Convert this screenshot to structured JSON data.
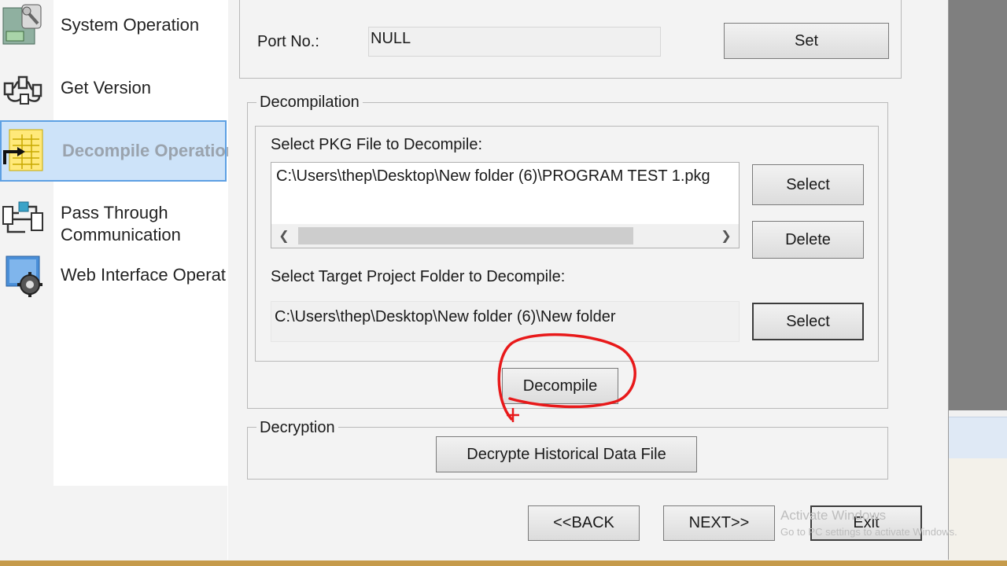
{
  "sidebar": {
    "items": [
      {
        "label": "System Operation",
        "icon": "system-operation-icon"
      },
      {
        "label": "Get Version",
        "icon": "get-version-icon"
      },
      {
        "label": "Decompile Operation",
        "icon": "decompile-operation-icon",
        "active": true
      },
      {
        "label": "Pass Through Communication",
        "line1": "Pass Through",
        "line2": "Communication",
        "icon": "pass-through-icon"
      },
      {
        "label": "Web Interface Operation",
        "icon": "web-interface-icon"
      }
    ]
  },
  "port": {
    "label": "Port No.:",
    "value": "NULL",
    "set_button": "Set"
  },
  "decompilation": {
    "title": "Decompilation",
    "pkg_label": "Select PKG File to Decompile:",
    "pkg_path": "C:\\Users\\thep\\Desktop\\New folder (6)\\PROGRAM TEST 1.pkg",
    "select_button": "Select",
    "delete_button": "Delete",
    "target_label": "Select Target Project Folder to Decompile:",
    "target_path": "C:\\Users\\thep\\Desktop\\New folder (6)\\New folder",
    "target_select_button": "Select",
    "decompile_button": "Decompile"
  },
  "decryption": {
    "title": "Decryption",
    "decrypt_button": "Decrypte Historical Data File"
  },
  "footer": {
    "back_button": "<<BACK",
    "next_button": "NEXT>>",
    "exit_button": "Exit"
  },
  "watermark": {
    "line1": "Activate Windows",
    "line2": "Go to PC settings to activate Windows."
  },
  "colors": {
    "annotation": "#e8191a",
    "selection": "#cde3f9",
    "selection_border": "#5da0e3"
  }
}
